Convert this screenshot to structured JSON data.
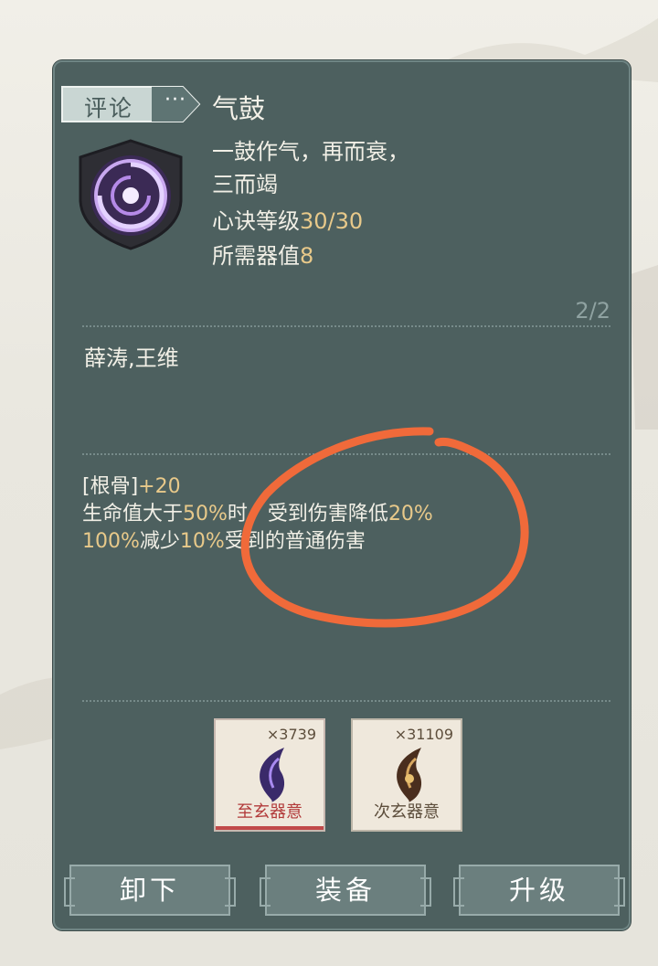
{
  "header": {
    "comment_tab": "评论",
    "more_dots": "···",
    "skill_name": "气鼓"
  },
  "skill": {
    "icon": "swirl-shield-icon",
    "desc_line1": "一鼓作气，再而衰，",
    "desc_line2": "三而竭",
    "level_label": "心诀等级",
    "level_value": "30/30",
    "cost_label": "所需器值",
    "cost_value": "8",
    "page": "2/2"
  },
  "owners": "薛涛,王维",
  "effects": {
    "stat_label": "[根骨]",
    "stat_value": "+20",
    "line2_a": "生命值大于",
    "line2_b": "50%",
    "line2_c": "时，受到伤害降低",
    "line2_d": "20%",
    "line3_a": "100%",
    "line3_b": "减少",
    "line3_c": "10%",
    "line3_d": "受到的普通伤害"
  },
  "items": [
    {
      "name": "至玄器意",
      "count": "×3739",
      "icon": "purple-blade-icon",
      "name_color": "#b23a3a"
    },
    {
      "name": "次玄器意",
      "count": "×31109",
      "icon": "bronze-blade-icon",
      "name_color": "#5d4e3c"
    }
  ],
  "buttons": {
    "unequip": "卸下",
    "equip": "装备",
    "upgrade": "升级"
  },
  "colors": {
    "panel": "#4d605f",
    "highlight_text": "#e8c98a",
    "annotation_circle": "#f06a3a"
  }
}
